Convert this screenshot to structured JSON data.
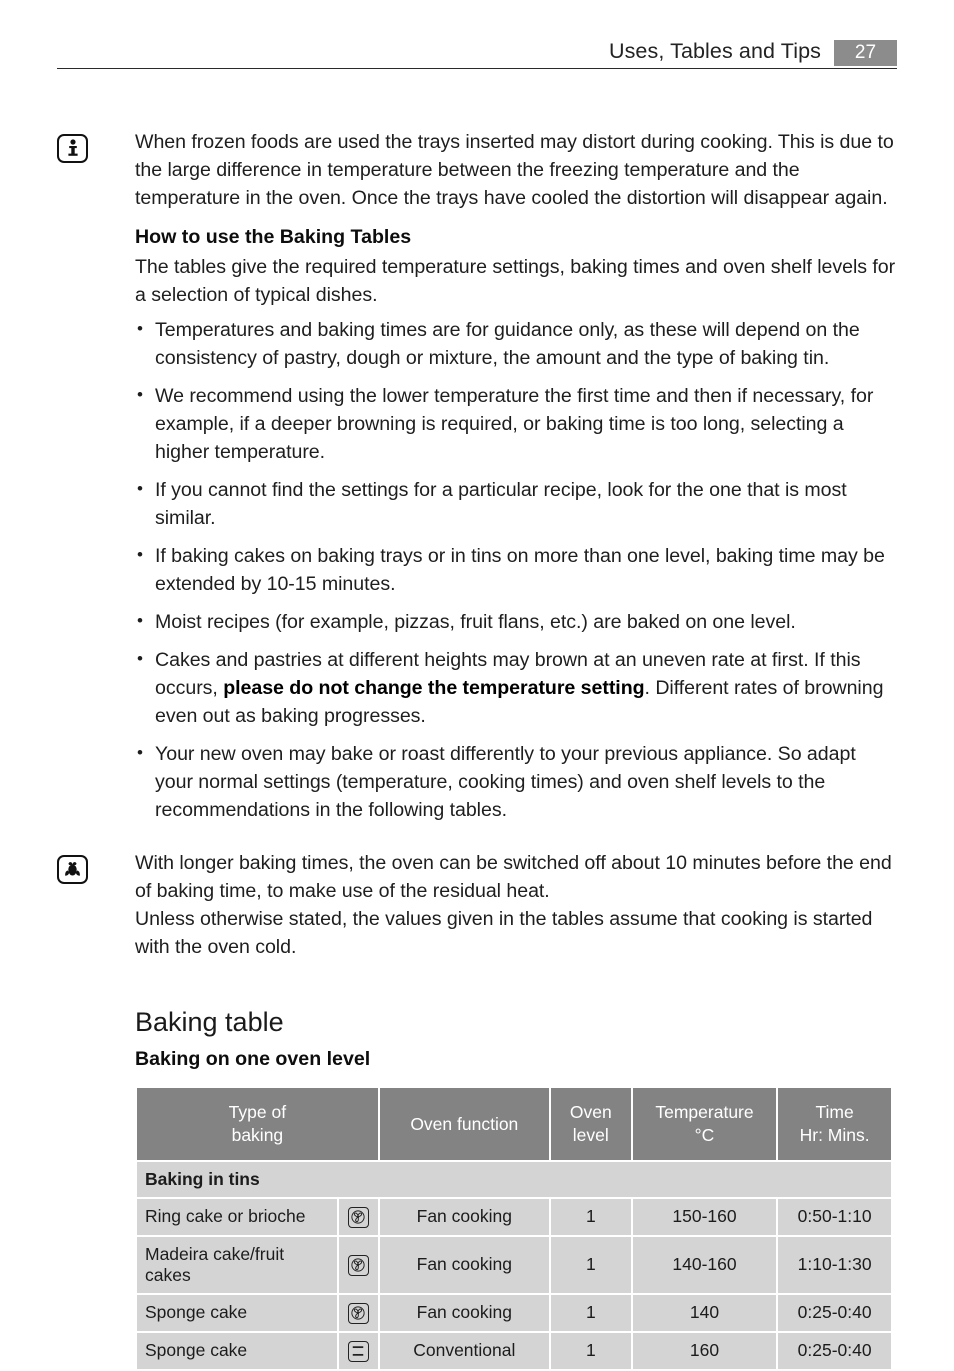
{
  "header": {
    "title": "Uses, Tables and Tips",
    "page_number": "27"
  },
  "info_block": {
    "icon": "info-icon",
    "paragraph": "When frozen foods are used the trays inserted may distort during cooking. This is due to the large difference in temperature between the freezing temperature and the temperature in the oven. Once the trays have cooled the distortion will disappear again.",
    "subheading": "How to use the Baking Tables",
    "intro": "The tables give the required temperature settings, baking times and oven shelf levels for a selection of typical dishes.",
    "bullets": [
      {
        "pre": "Temperatures and baking times are for guidance only, as these will depend on the consistency of pastry, dough or mixture, the amount and the type of baking tin.",
        "bold": "",
        "post": ""
      },
      {
        "pre": "We recommend using the lower temperature the first time and then if necessary, for example, if a deeper browning is required, or baking time is too long, selecting a higher temperature.",
        "bold": "",
        "post": ""
      },
      {
        "pre": "If you cannot find the settings for a particular recipe, look for the one that is most similar.",
        "bold": "",
        "post": ""
      },
      {
        "pre": "If baking cakes on baking trays or in tins on more than one level, baking time may be extended by 10-15 minutes.",
        "bold": "",
        "post": ""
      },
      {
        "pre": "Moist recipes (for example, pizzas, fruit flans, etc.) are baked on one level.",
        "bold": "",
        "post": ""
      },
      {
        "pre": "Cakes and pastries at different heights may brown at an uneven rate at first. If this occurs, ",
        "bold": "please do not change the temperature setting",
        "post": ". Different rates of browning even out as baking progresses."
      },
      {
        "pre": "Your new oven may bake or roast differently to your previous appliance. So adapt your normal settings (temperature, cooking times) and oven shelf levels to the recommendations in the following tables.",
        "bold": "",
        "post": ""
      }
    ]
  },
  "eco_block": {
    "icon": "flower-icon",
    "paragraph1": "With longer baking times, the oven can be switched off about 10 minutes before the end of baking time, to make use of the residual heat.",
    "paragraph2": "Unless otherwise stated, the values given in the tables assume that cooking is started with the oven cold."
  },
  "baking_section": {
    "title": "Baking table",
    "subtitle": "Baking on one oven level"
  },
  "table": {
    "headers": {
      "type": "Type of\nbaking",
      "type_line1": "Type of",
      "type_line2": "baking",
      "function": "Oven function",
      "level_line1": "Oven",
      "level_line2": "level",
      "temp_line1": "Temperature",
      "temp_line2": "°C",
      "time_line1": "Time",
      "time_line2": "Hr: Mins."
    },
    "groups": [
      {
        "label": "Baking in tins",
        "rows": [
          {
            "type": "Ring cake or brioche",
            "icon": "fan-cooking-icon",
            "function": "Fan cooking",
            "level": "1",
            "temperature": "150-160",
            "time": "0:50-1:10"
          },
          {
            "type": "Madeira cake/fruit cakes",
            "icon": "fan-cooking-icon",
            "function": "Fan cooking",
            "level": "1",
            "temperature": "140-160",
            "time": "1:10-1:30"
          },
          {
            "type": "Sponge cake",
            "icon": "fan-cooking-icon",
            "function": "Fan cooking",
            "level": "1",
            "temperature": "140",
            "time": "0:25-0:40"
          },
          {
            "type": "Sponge cake",
            "icon": "conventional-icon",
            "function": "Conventional",
            "level": "1",
            "temperature": "160",
            "time": "0:25-0:40"
          }
        ]
      }
    ]
  },
  "colors": {
    "header_gray": "#838383",
    "cell_gray": "#d4d4d4",
    "badge_gray": "#8c8c8c",
    "text": "#1e1e1e"
  }
}
